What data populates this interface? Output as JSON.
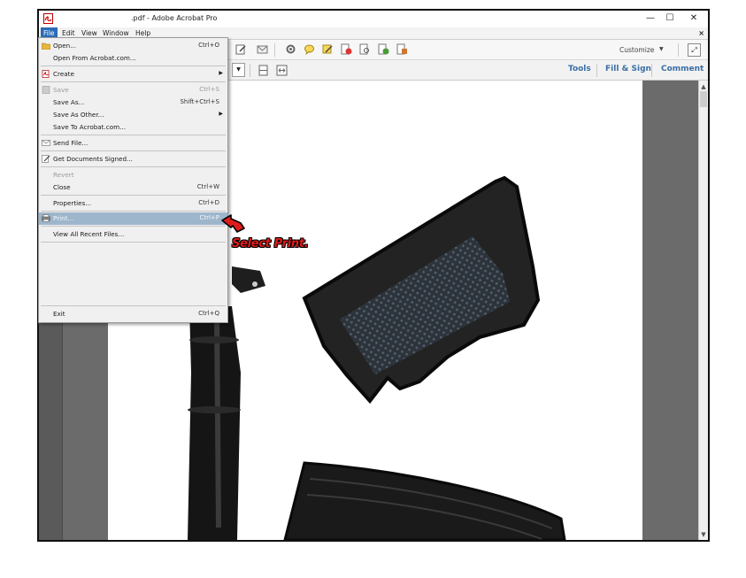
{
  "window": {
    "title": ".pdf - Adobe Acrobat Pro",
    "controls": {
      "minimize": "—",
      "maximize": "☐",
      "close": "✕"
    }
  },
  "menubar": {
    "items": [
      "File",
      "Edit",
      "View",
      "Window",
      "Help"
    ],
    "close_glyph": "×"
  },
  "toolbar": {
    "customize_label": "Customize",
    "customize_caret": "▼",
    "expand_glyph": "⤢"
  },
  "toolbar2": {
    "zoom_caret": "▼",
    "tools_label": "Tools",
    "fillsign_label": "Fill & Sign",
    "comment_label": "Comment"
  },
  "scrollbar": {
    "up": "▲",
    "down": "▼"
  },
  "file_menu": {
    "items": [
      {
        "label": "Open...",
        "shortcut": "Ctrl+O",
        "icon": "open-folder-icon"
      },
      {
        "label": "Open From Acrobat.com..."
      },
      {
        "label": "Create",
        "submenu": "▶",
        "icon": "create-pdf-icon"
      },
      {
        "label": "Save",
        "shortcut": "Ctrl+S",
        "disabled": true,
        "icon": "save-disk-icon"
      },
      {
        "label": "Save As...",
        "shortcut": "Shift+Ctrl+S"
      },
      {
        "label": "Save As Other...",
        "submenu": "▶"
      },
      {
        "label": "Save To Acrobat.com..."
      },
      {
        "label": "Send File...",
        "icon": "envelope-icon"
      },
      {
        "label": "Get Documents Signed...",
        "icon": "sign-document-icon"
      },
      {
        "label": "Revert",
        "disabled": true
      },
      {
        "label": "Close",
        "shortcut": "Ctrl+W"
      },
      {
        "label": "Properties...",
        "shortcut": "Ctrl+D"
      },
      {
        "label": "Print...",
        "shortcut": "Ctrl+P",
        "highlighted": true,
        "icon": "printer-icon"
      },
      {
        "label": "View All Recent Files..."
      },
      {
        "label": "Exit",
        "shortcut": "Ctrl+Q"
      }
    ]
  },
  "callout": {
    "text": "Select Print.",
    "color": "#e01b1b"
  },
  "colors": {
    "menu_highlight": "#9eb6cc",
    "active_menu": "#2b6cb6",
    "toolbar_accent": "#3a6ea5"
  }
}
